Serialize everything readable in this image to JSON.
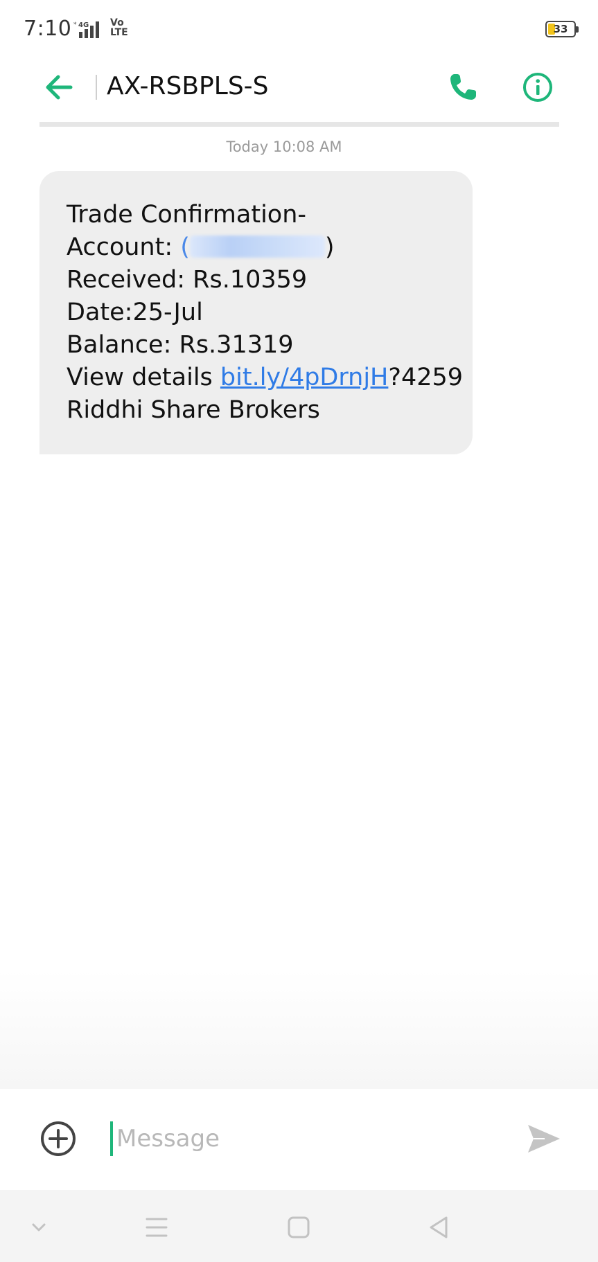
{
  "status_bar": {
    "time": "7:10",
    "network": "4G",
    "volte_top": "Vo",
    "volte_bottom": "LTE",
    "battery": "33"
  },
  "header": {
    "contact": "AX-RSBPLS-S",
    "back_icon": "arrow-left-icon",
    "call_icon": "phone-icon",
    "info_icon": "info-icon"
  },
  "conversation": {
    "timestamp": "Today 10:08 AM",
    "message": {
      "line1": "Trade Confirmation-",
      "account_label": "Account: ",
      "account_open": "(",
      "account_close": ")",
      "line3": "Received: Rs.10359",
      "line4": "Date:25-Jul",
      "line5": "Balance: Rs.31319",
      "view_prefix": "View details ",
      "link": "bit.ly/4pDrnjH",
      "link_suffix": "?4259",
      "line7": "Riddhi Share Brokers"
    }
  },
  "composer": {
    "placeholder": "Message",
    "add_icon": "plus-circle-icon",
    "send_icon": "send-icon"
  },
  "nav": {
    "icons": [
      "chevron-down-icon",
      "menu-icon",
      "home-square-icon",
      "back-triangle-icon"
    ]
  },
  "colors": {
    "accent": "#1eb67a",
    "link": "#2f7be6",
    "bubble": "#eeeeee"
  }
}
